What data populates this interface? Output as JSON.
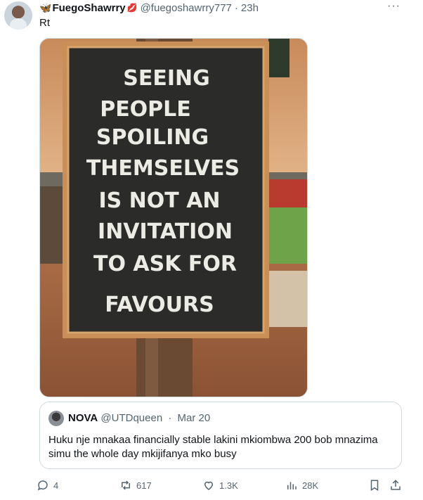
{
  "tweet": {
    "display_name": "FuegoShawrry",
    "handle": "@fuegoshawrry777",
    "separator": "·",
    "time": "23h",
    "text": "Rt",
    "more_label": "···"
  },
  "media": {
    "chalkboard_lines": [
      "SEEING",
      "PEOPLE",
      "SPOILING",
      "THEMSELVES",
      "IS NOT AN",
      "INVITATION",
      "TO ASK FOR",
      "FAVOURS"
    ]
  },
  "quote": {
    "display_name": "NOVA",
    "handle": "@UTDqueen",
    "separator": "·",
    "time": "Mar 20",
    "text": "Huku nje mnakaa financially stable lakini mkiombwa 200 bob mnazima simu the whole day mkijifanya mko busy"
  },
  "actions": {
    "replies": "4",
    "retweets": "617",
    "likes": "1.3K",
    "views": "28K"
  },
  "icons": {
    "reply": "reply-icon",
    "retweet": "retweet-icon",
    "like": "heart-icon",
    "views": "views-icon",
    "bookmark": "bookmark-icon",
    "share": "share-icon",
    "verified_emoji": "butterfly-icon",
    "name_emoji": "lips-icon"
  },
  "colors": {
    "text": "#0f1419",
    "secondary": "#536471",
    "border": "#cfd9de",
    "accent": "#1d9bf0"
  }
}
